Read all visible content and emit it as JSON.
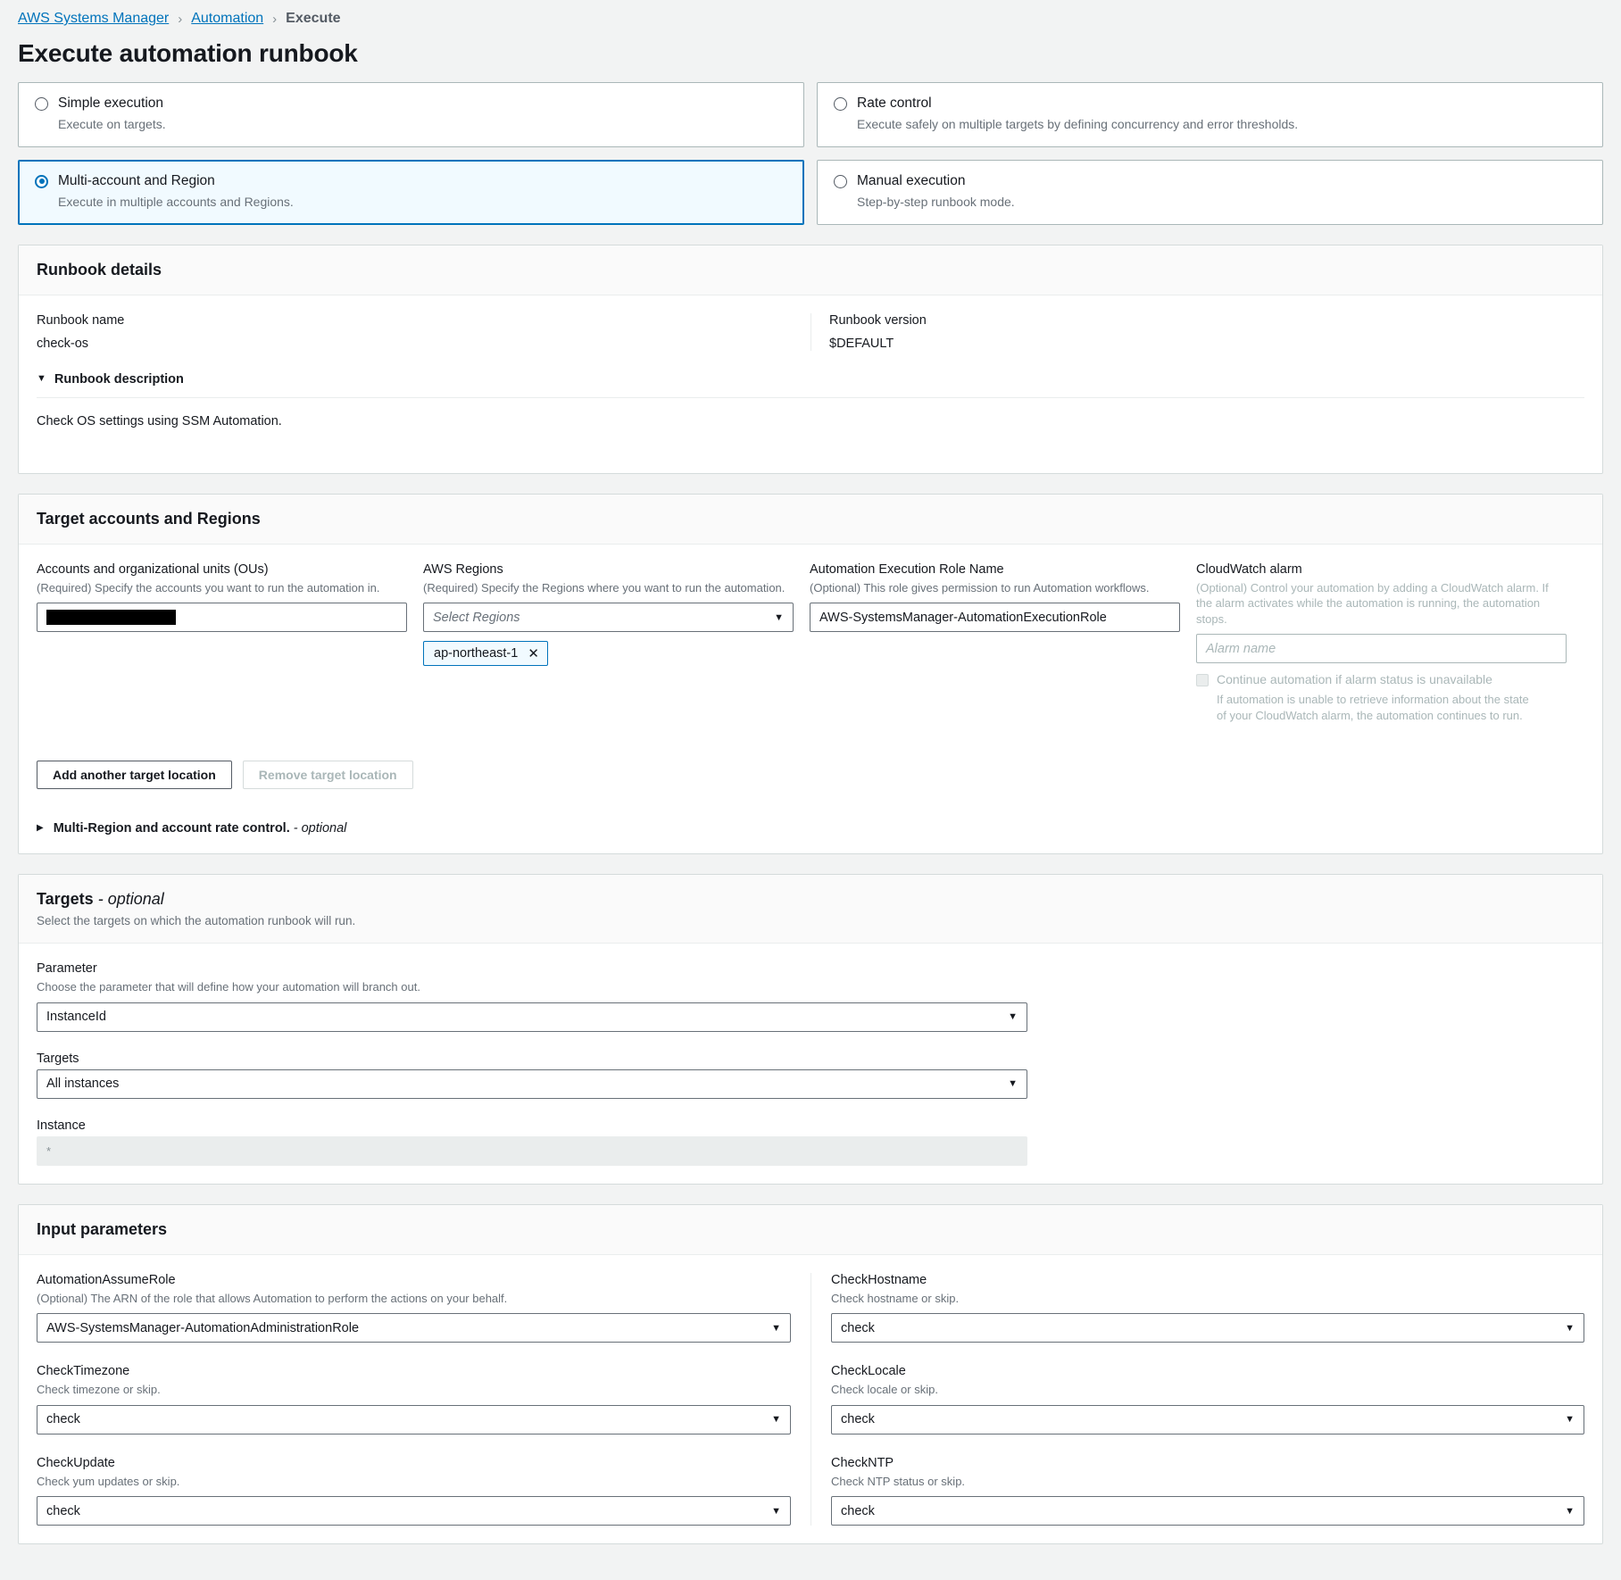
{
  "breadcrumb": {
    "items": [
      {
        "label": "AWS Systems Manager",
        "type": "link"
      },
      {
        "label": "Automation",
        "type": "link"
      },
      {
        "label": "Execute",
        "type": "current"
      }
    ],
    "separator": "›"
  },
  "page_title": "Execute automation runbook",
  "execution_modes": [
    {
      "label": "Simple execution",
      "desc": "Execute on targets.",
      "selected": false
    },
    {
      "label": "Rate control",
      "desc": "Execute safely on multiple targets by defining concurrency and error thresholds.",
      "selected": false
    },
    {
      "label": "Multi-account and Region",
      "desc": "Execute in multiple accounts and Regions.",
      "selected": true
    },
    {
      "label": "Manual execution",
      "desc": "Step-by-step runbook mode.",
      "selected": false
    }
  ],
  "runbook_details": {
    "title": "Runbook details",
    "name_label": "Runbook name",
    "name_value": "check-os",
    "version_label": "Runbook version",
    "version_value": "$DEFAULT",
    "description_toggle": "Runbook description",
    "description_toggle_icon": "triangle-down",
    "description_text": "Check OS settings using SSM Automation."
  },
  "target_accounts": {
    "title": "Target accounts and Regions",
    "accounts": {
      "label": "Accounts and organizational units (OUs)",
      "hint": "(Required) Specify the accounts you want to run the automation in.",
      "value": "",
      "redacted": true
    },
    "regions": {
      "label": "AWS Regions",
      "hint": "(Required) Specify the Regions where you want to run the automation.",
      "placeholder": "Select Regions",
      "caret_icon": "chevron-down-icon",
      "tokens": [
        {
          "label": "ap-northeast-1",
          "remove_icon": "close-icon"
        }
      ]
    },
    "role": {
      "label": "Automation Execution Role Name",
      "hint": "(Optional) This role gives permission to run Automation workflows.",
      "value": "AWS-SystemsManager-AutomationExecutionRole"
    },
    "cloudwatch": {
      "label": "CloudWatch alarm",
      "hint": "(Optional) Control your automation by adding a CloudWatch alarm. If the alarm activates while the automation is running, the automation stops.",
      "placeholder": "Alarm name",
      "checkbox_label": "Continue automation if alarm status is unavailable",
      "checkbox_hint": "If automation is unable to retrieve information about the state of your CloudWatch alarm, the automation continues to run.",
      "checkbox_checked": false
    },
    "add_button": "Add another target location",
    "remove_button": "Remove target location",
    "remove_disabled": true,
    "rate_control_toggle": "Multi-Region and account rate control.",
    "rate_control_optional": "- optional",
    "rate_control_icon": "triangle-right"
  },
  "targets": {
    "title": "Targets",
    "title_optional": "- optional",
    "subtitle": "Select the targets on which the automation runbook will run.",
    "parameter": {
      "label": "Parameter",
      "hint": "Choose the parameter that will define how your automation will branch out.",
      "value": "InstanceId",
      "caret_icon": "chevron-down-icon"
    },
    "targets_select": {
      "label": "Targets",
      "value": "All instances",
      "caret_icon": "chevron-down-icon"
    },
    "instance": {
      "label": "Instance",
      "value": "*",
      "readonly": true
    }
  },
  "input_parameters": {
    "title": "Input parameters",
    "left": [
      {
        "label": "AutomationAssumeRole",
        "hint": "(Optional) The ARN of the role that allows Automation to perform the actions on your behalf.",
        "value": "AWS-SystemsManager-AutomationAdministrationRole",
        "caret_icon": "chevron-down-icon"
      },
      {
        "label": "CheckTimezone",
        "hint": "Check timezone or skip.",
        "value": "check",
        "caret_icon": "chevron-down-icon"
      },
      {
        "label": "CheckUpdate",
        "hint": "Check yum updates or skip.",
        "value": "check",
        "caret_icon": "chevron-down-icon"
      }
    ],
    "right": [
      {
        "label": "CheckHostname",
        "hint": "Check hostname or skip.",
        "value": "check",
        "caret_icon": "chevron-down-icon"
      },
      {
        "label": "CheckLocale",
        "hint": "Check locale or skip.",
        "value": "check",
        "caret_icon": "chevron-down-icon"
      },
      {
        "label": "CheckNTP",
        "hint": "Check NTP status or skip.",
        "value": "check",
        "caret_icon": "chevron-down-icon"
      }
    ]
  },
  "colors": {
    "accent": "#0073bb",
    "link": "#0073bb",
    "page_bg": "#f2f3f3",
    "panel_bg": "#ffffff",
    "border": "#d5dbdb",
    "muted_text": "#687078"
  }
}
